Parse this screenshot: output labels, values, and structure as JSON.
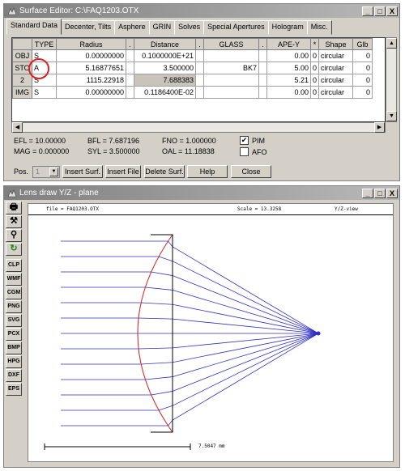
{
  "editor": {
    "title": "Surface Editor: C:\\FAQ1203.OTX",
    "tabs": [
      "Standard Data",
      "Decenter, Tilts",
      "Asphere",
      "GRIN",
      "Solves",
      "Special Apertures",
      "Hologram",
      "Misc."
    ],
    "columns": [
      "TYPE",
      "Radius",
      ".",
      "Distance",
      ".",
      "GLASS",
      ".",
      "APE-Y",
      "*",
      "Shape",
      "Glb"
    ],
    "rows": [
      {
        "label": "OBJ",
        "type": "S",
        "radius": "0.00000000",
        "distance": "0.1000000E+21",
        "glass": "",
        "apey": "0.00",
        "ape_flag": "0",
        "shape": "circular",
        "glb": "0"
      },
      {
        "label": "STO",
        "type": "A",
        "radius": "5.16877651",
        "distance": "3.500000",
        "glass": "BK7",
        "apey": "5.00",
        "ape_flag": "0",
        "shape": "circular",
        "glb": "0"
      },
      {
        "label": "2",
        "type": "S",
        "radius": "1115.22918",
        "distance": "7.688383",
        "glass": "",
        "apey": "5.21",
        "ape_flag": "0",
        "shape": "circular",
        "glb": "0"
      },
      {
        "label": "IMG",
        "type": "S",
        "radius": "0.00000000",
        "distance": "0.1186400E-02",
        "glass": "",
        "apey": "0.00",
        "ape_flag": "0",
        "shape": "circular",
        "glb": "0"
      }
    ],
    "info": {
      "efl": "EFL = 10.00000",
      "bfl": "BFL = 7.687196",
      "fno": "FNO = 1.000000",
      "mag": "MAG = 0.000000",
      "syl": "SYL = 3.500000",
      "oal": "OAL = 11.18838"
    },
    "pim": {
      "label": "PIM",
      "checked": true,
      "mark": "✔"
    },
    "afo": {
      "label": "AFO",
      "checked": false
    },
    "pos_label": "Pos.",
    "pos_value": "1",
    "buttons": {
      "insert_surf": "Insert Surf.",
      "insert_file": "Insert File",
      "delete_surf": "Delete Surf.",
      "help": "Help",
      "close": "Close"
    },
    "title_buttons": [
      "_",
      "□",
      "X"
    ]
  },
  "lensdraw": {
    "title": "Lens draw Y/Z - plane",
    "file_label": "file = FAQ1203.OTX",
    "scale_label": "Scale = 13.3258",
    "view_label": "Y/Z-view",
    "scale_bar": "7.5047 mm",
    "toolbar": [
      "CLP",
      "WMF",
      "CGM",
      "PNG",
      "SVG",
      "PCX",
      "BMP",
      "HPG",
      "DXF",
      "EPS"
    ],
    "toolbar_icons": [
      "printer-icon",
      "tools-icon",
      "zoom-icon",
      "refresh-icon"
    ],
    "colors": {
      "rays": "#3030c0",
      "surface": "#d02020",
      "outline": "#000000"
    }
  },
  "annotation": {
    "color": "#e02020"
  }
}
